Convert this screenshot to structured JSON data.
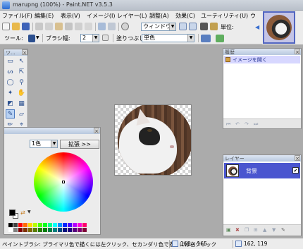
{
  "window": {
    "title": "marupng (100%) - Paint.NET v3.5.3"
  },
  "menu": [
    {
      "label": "ファイル(F)"
    },
    {
      "label": "編集(E)"
    },
    {
      "label": "表示(V)"
    },
    {
      "label": "イメージ(I)"
    },
    {
      "label": "レイヤー(L)"
    },
    {
      "label": "調整(A)"
    },
    {
      "label": "効果(C)"
    },
    {
      "label": "ユーティリティ(U)"
    },
    {
      "label": "ウ"
    }
  ],
  "toolbar1": {
    "zoom_combo": "ウィンドウ",
    "units_label": "単位:"
  },
  "toolbar2": {
    "tool_label": "ツール:",
    "brush_width_label": "ブラシ幅:",
    "brush_width_value": "2",
    "fill_label": "塗りつぶし:",
    "fill_value": "単色"
  },
  "panels": {
    "tools_title": "ツ...",
    "history_title": "履歴",
    "history_items": [
      {
        "label": "イメージを開く"
      }
    ],
    "layers_title": "レイヤー",
    "layers_items": [
      {
        "label": "背景",
        "visible": true
      }
    ],
    "colors_mode": "1色",
    "colors_more_button": "拡張 >>"
  },
  "statusbar": {
    "hint": "ペイントブラシ: プライマリ色で描くには左クリック、セカンダリ色で描くには右クリック",
    "size": "168 x 165",
    "pointer": "162, 119"
  },
  "colors": {
    "accent": "#4a55cf",
    "selection": "#d7d7ff",
    "primary": "#000000",
    "secondary": "#ffffff"
  },
  "palette": [
    "#000000",
    "#404040",
    "#ff0000",
    "#ff6a00",
    "#ffd800",
    "#b6ff00",
    "#4cff00",
    "#00ff21",
    "#00ff90",
    "#00ffff",
    "#0094ff",
    "#0026ff",
    "#4800ff",
    "#b200ff",
    "#ff00dc",
    "#ff006e",
    "#ffffff",
    "#808080",
    "#7f0000",
    "#7f3300",
    "#7f6a00",
    "#5b7f00",
    "#267f00",
    "#007f0e",
    "#007f46",
    "#007f7f",
    "#004a7f",
    "#00137f",
    "#21007f",
    "#57007f",
    "#7f006e",
    "#7f0037"
  ]
}
